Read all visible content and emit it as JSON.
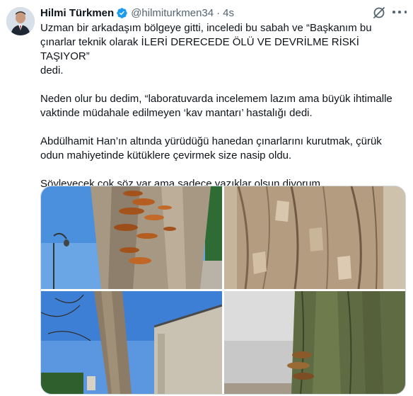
{
  "author": {
    "display_name": "Hilmi Türkmen",
    "handle": "@hilmiturkmen34",
    "separator": "·",
    "time": "4s",
    "verified_icon": "verified-badge-icon",
    "avatar_icon": "avatar"
  },
  "tweet": {
    "paragraphs": [
      "Uzman bir arkadaşım bölgeye gitti, inceledi bu sabah ve “Başkanım bu\nçınarlar teknik olarak İLERİ DERECEDE ÖLÜ VE DEVRİLME RİSKİ TAŞIYOR”\ndedi.",
      "Neden olur bu dedim, “laboratuvarda incelemem lazım ama büyük ihtimalle\nvaktinde müdahale edilmeyen ‘kav mantarı’ hastalığı dedi.",
      "Abdülhamit Han’ın altında yürüdüğü hanedan çınarlarını kurutmak, çürük\nodun mahiyetinde kütüklere çevirmek size nasip oldu.",
      "Söyleyecek çok söz var ama sadece yazıklar olsun diyorum."
    ]
  },
  "actions": {
    "grok_icon": "grok-icon",
    "more_icon": "more-options-icon"
  },
  "colors": {
    "accent": "#1d9bf0",
    "secondary_text": "#536471",
    "border": "#cfd9de"
  }
}
